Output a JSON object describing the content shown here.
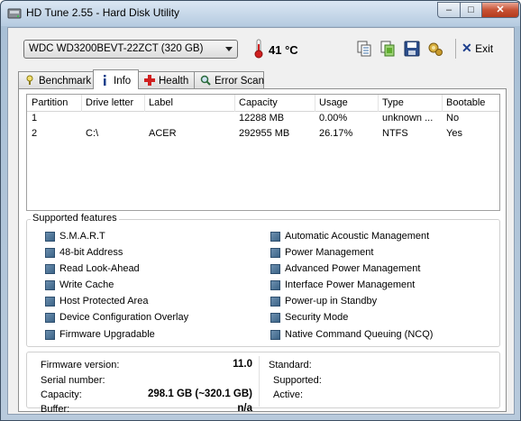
{
  "window": {
    "title": "HD Tune 2.55 - Hard Disk Utility",
    "minimize_label": "–",
    "maximize_label": "□",
    "close_label": "✕"
  },
  "toolbar": {
    "drive": "WDC WD3200BEVT-22ZCT (320 GB)",
    "temperature": "41 °C",
    "exit_label": "Exit",
    "icons": [
      "copy-text-icon",
      "copy-screenshot-icon",
      "save-icon",
      "options-icon"
    ]
  },
  "tabs": [
    {
      "label": "Benchmark",
      "icon": "benchmark-icon"
    },
    {
      "label": "Info",
      "icon": "info-icon",
      "active": true
    },
    {
      "label": "Health",
      "icon": "health-icon"
    },
    {
      "label": "Error Scan",
      "icon": "error-scan-icon"
    }
  ],
  "partitions": {
    "headers": [
      "Partition",
      "Drive letter",
      "Label",
      "Capacity",
      "Usage",
      "Type",
      "Bootable"
    ],
    "rows": [
      [
        "1",
        "",
        "",
        "12288 MB",
        "0.00%",
        "unknown ...",
        "No"
      ],
      [
        "2",
        "C:\\",
        "ACER",
        "292955 MB",
        "26.17%",
        "NTFS",
        "Yes"
      ]
    ]
  },
  "features": {
    "title": "Supported features",
    "left": [
      "S.M.A.R.T",
      "48-bit Address",
      "Read Look-Ahead",
      "Write Cache",
      "Host Protected Area",
      "Device Configuration Overlay",
      "Firmware Upgradable"
    ],
    "right": [
      "Automatic Acoustic Management",
      "Power Management",
      "Advanced Power Management",
      "Interface Power Management",
      "Power-up in Standby",
      "Security Mode",
      "Native Command Queuing (NCQ)"
    ]
  },
  "drive_info": {
    "firmware_label": "Firmware version:",
    "firmware_value": "11.0",
    "serial_label": "Serial number:",
    "serial_value": "",
    "capacity_label": "Capacity:",
    "capacity_value": "298.1 GB (~320.1 GB)",
    "buffer_label": "Buffer:",
    "buffer_value": "n/a",
    "standard_label": "Standard:",
    "supported_label": "Supported:",
    "active_label": "Active:"
  },
  "colors": {
    "checkbox": "#4a7197",
    "title_gradient_top": "#dbe7f3",
    "close_red": "#c75234"
  }
}
